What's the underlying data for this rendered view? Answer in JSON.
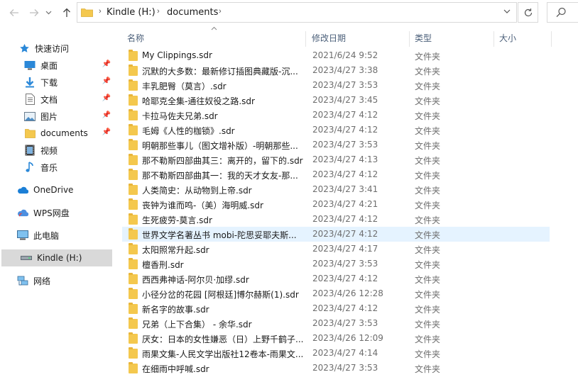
{
  "address_bar": {
    "path": [
      "Kindle (H:)",
      "documents"
    ]
  },
  "toolbar_icons": {
    "back": "arrow-left-icon",
    "forward": "arrow-right-icon",
    "recent": "chevron-down-icon",
    "up": "arrow-up-icon",
    "refresh": "refresh-icon",
    "search": "search-icon"
  },
  "nav": {
    "items": [
      {
        "label": "快速访问",
        "icon": "star-icon"
      },
      {
        "label": "桌面",
        "icon": "desktop-icon",
        "pinned": true
      },
      {
        "label": "下载",
        "icon": "download-icon",
        "pinned": true
      },
      {
        "label": "文档",
        "icon": "document-icon",
        "pinned": true
      },
      {
        "label": "图片",
        "icon": "picture-icon",
        "pinned": true
      },
      {
        "label": "documents",
        "icon": "folder-icon",
        "pinned": true
      },
      {
        "label": "视频",
        "icon": "video-icon"
      },
      {
        "label": "音乐",
        "icon": "music-icon"
      },
      {
        "label": "OneDrive",
        "icon": "cloud-icon"
      },
      {
        "label": "WPS网盘",
        "icon": "wps-cloud-icon"
      },
      {
        "label": "此电脑",
        "icon": "computer-icon"
      },
      {
        "label": "Kindle (H:)",
        "icon": "drive-icon",
        "selected": true
      },
      {
        "label": "网络",
        "icon": "network-icon"
      }
    ]
  },
  "columns": {
    "name": "名称",
    "date": "修改日期",
    "type": "类型",
    "size": "大小"
  },
  "files": [
    {
      "name": "My Clippings.sdr",
      "date": "2021/6/24 9:52",
      "type": "文件夹"
    },
    {
      "name": "沉默的大多数：最新修订插图典藏版-沉...",
      "date": "2023/4/27 3:38",
      "type": "文件夹"
    },
    {
      "name": "丰乳肥臀（莫言）.sdr",
      "date": "2023/4/27 3:53",
      "type": "文件夹"
    },
    {
      "name": "哈耶克全集-通往奴役之路.sdr",
      "date": "2023/4/27 3:45",
      "type": "文件夹"
    },
    {
      "name": "卡拉马佐夫兄弟.sdr",
      "date": "2023/4/27 4:12",
      "type": "文件夹"
    },
    {
      "name": "毛姆《人性的枷锁》.sdr",
      "date": "2023/4/27 4:12",
      "type": "文件夹"
    },
    {
      "name": "明朝那些事儿（图文增补版）-明朝那些...",
      "date": "2023/4/27 3:53",
      "type": "文件夹"
    },
    {
      "name": "那不勒斯四部曲其三：离开的，留下的.sdr",
      "date": "2023/4/27 4:13",
      "type": "文件夹"
    },
    {
      "name": "那不勒斯四部曲其一：我的天才女友-那...",
      "date": "2023/4/27 4:12",
      "type": "文件夹"
    },
    {
      "name": "人类简史：从动物到上帝.sdr",
      "date": "2023/4/27 3:41",
      "type": "文件夹"
    },
    {
      "name": "丧钟为谁而鸣-（美）海明威.sdr",
      "date": "2023/4/27 4:21",
      "type": "文件夹"
    },
    {
      "name": "生死疲劳-莫言.sdr",
      "date": "2023/4/27 4:12",
      "type": "文件夹"
    },
    {
      "name": "世界文学名著丛书 mobi-陀思妥耶夫斯...",
      "date": "2023/4/27 4:12",
      "type": "文件夹",
      "hover": true
    },
    {
      "name": "太阳照常升起.sdr",
      "date": "2023/4/27 4:17",
      "type": "文件夹"
    },
    {
      "name": "檀香刑.sdr",
      "date": "2023/4/27 3:53",
      "type": "文件夹"
    },
    {
      "name": "西西弗神话-阿尔贝·加缪.sdr",
      "date": "2023/4/27 4:12",
      "type": "文件夹"
    },
    {
      "name": "小径分岔的花园 [阿根廷]博尔赫斯(1).sdr",
      "date": "2023/4/26 12:28",
      "type": "文件夹"
    },
    {
      "name": "新名字的故事.sdr",
      "date": "2023/4/27 4:12",
      "type": "文件夹"
    },
    {
      "name": "兄弟（上下合集） - 余华.sdr",
      "date": "2023/4/27 3:53",
      "type": "文件夹"
    },
    {
      "name": "厌女：日本的女性嫌恶（日）上野千鹤子...",
      "date": "2023/4/26 12:09",
      "type": "文件夹"
    },
    {
      "name": "雨果文集-人民文学出版社12卷本-雨果文...",
      "date": "2023/4/27 4:14",
      "type": "文件夹"
    },
    {
      "name": "在细雨中呼喊.sdr",
      "date": "2023/4/27 3:53",
      "type": "文件夹"
    }
  ]
}
